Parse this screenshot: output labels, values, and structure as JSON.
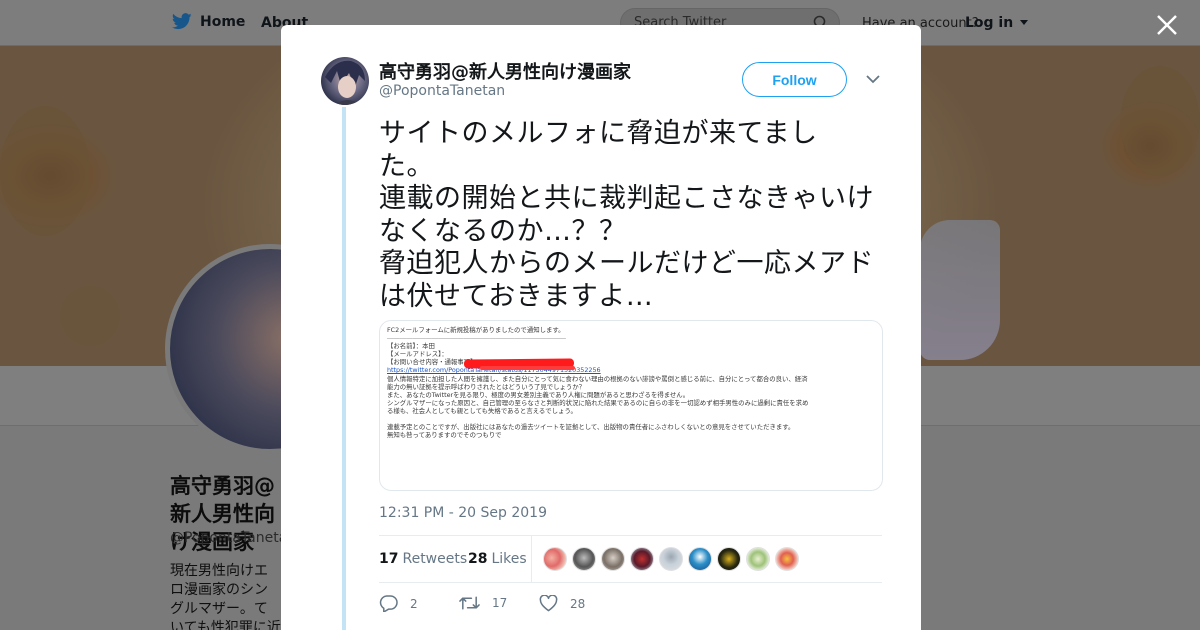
{
  "topnav": {
    "home_label": "Home",
    "about_label": "About",
    "search_placeholder": "Search Twitter",
    "have_account": "Have an account?",
    "login_label": "Log in"
  },
  "profile_bg": {
    "name": "高守勇羽@新人男性向け漫画家",
    "handle": "@PopontaTanetan",
    "bio": "現在男性向けエロ漫画家のシングルマザー。ていても性犯罪に近い話題が苦手な方"
  },
  "tweet": {
    "author_name": "高守勇羽@新人男性向け漫画家",
    "author_handle": "@PopontaTanetan",
    "follow_label": "Follow",
    "text_lines": [
      "サイトのメルフォに脅迫が来てまし",
      "た。",
      "連載の開始と共に裁判起こさなきゃいけ",
      "なくなるのか…？？",
      "脅迫犯人からのメールだけど一応メアド",
      "は伏せておきますよ…"
    ],
    "media_lines": [
      "FC2メールフォームに新規投稿がありましたので通知します。",
      "――――――――――――――――――――――――――――",
      "【お名前】：本田",
      "【メールアドレス】：",
      "【お問い合せ内容・通報事項】：",
      "https://twitter.com/PopontaTanetan/status/1175044971520352256",
      "個人情報特定に加担した人間を擁護し、また自分にとって気に食わない理由の根拠のない誹謗や罵倒と感じる前に、自分にとって都合の良い、経済",
      "能力の無い証拠を提示呼ばわりされたとはどういう了見でしょうか？",
      "また、あなたのTwitterを見る限り、極度の男女差別主義であり人権に問題があると思わざるを得ません。",
      "シングルマザーになった原因と、自己管理の至らなさと判断的状況に陥れた結果であるのに自らの非を一切認めず相手男性のみに過剰に責任を求め",
      "る様も、社会人としても親としても失格であると言えるでしょう。",
      "",
      "連載予定とのことですが、出版社にはあなたの過去ツイートを証拠として、出版物の責任者にふさわしくないとの意見をさせていただきます。",
      "無知も咎ってありますのでそのつもりで"
    ],
    "timestamp": "12:31 PM - 20 Sep 2019",
    "retweets_count": "17",
    "retweets_label": "Retweets",
    "likes_count": "28",
    "likes_label": "Likes",
    "reply_count": "2",
    "retweet_action_count": "17",
    "like_action_count": "28"
  },
  "colors": {
    "accent": "#1da1f2",
    "thread_line": "#c4e4f5",
    "redaction": "#ff1b1b"
  }
}
